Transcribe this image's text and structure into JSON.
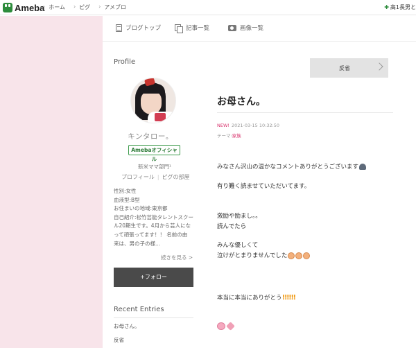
{
  "topbar": {
    "logo": "Ameba",
    "crumbs": [
      "ホーム",
      "ピグ",
      "アメブロ"
    ],
    "right_text": "高1長男と"
  },
  "subnav": {
    "items": [
      {
        "label": "ブログトップ",
        "icon": "document-icon"
      },
      {
        "label": "記事一覧",
        "icon": "copy-icon"
      },
      {
        "label": "画像一覧",
        "icon": "camera-icon"
      }
    ]
  },
  "sidebar": {
    "profile_heading": "Profile",
    "nickname": "キンタロー。",
    "official_badge": "Amebaオフィシャル",
    "subtitle": "新米ママ部門¹",
    "link_profile": "プロフィール",
    "link_room": "ピグの部屋",
    "details": [
      "性別:女性",
      "血液型:B型",
      "お住まいの地域:東京都",
      "自己紹介:松竹芸能タレントスクー",
      "ル20期生です。4月から芸人にな",
      "って頑張ってます！！ 名前の由",
      "来は、男の子の様..."
    ],
    "read_more": "続きを見る >",
    "follow_button": "+フォロー",
    "recent_heading": "Recent Entries",
    "recent_entries": [
      "お母さん。",
      "反省"
    ]
  },
  "main": {
    "prev_entry": "反省",
    "title": "お母さん。",
    "new_badge": "NEW!",
    "date": "2021-03-15 10:32:50",
    "theme_label": "テーマ:",
    "theme_value": "家族",
    "body": [
      "みなさん沢山の温かなコメントありがとうございます",
      "有り難く読ませていただいてます。",
      "激励や励まし。。",
      "読んでたら",
      "みんな優しくて",
      "泣けがとまりませんでした",
      "本当に本当にありがとう"
    ]
  }
}
